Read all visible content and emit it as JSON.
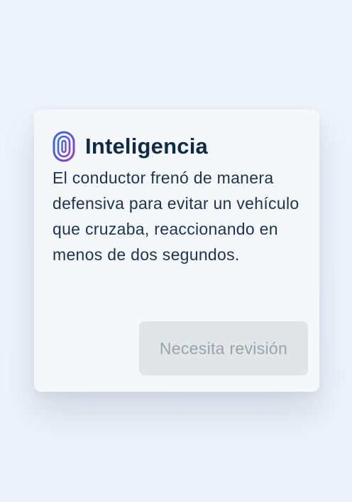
{
  "card": {
    "icon": "fingerprint-icon",
    "title": "Inteligencia",
    "description": "El conductor frenó de manera defensiva para evitar un vehículo que cruzaba, reaccionando en menos de dos segundos.",
    "review_button_label": "Necesita revisión"
  },
  "colors": {
    "icon_gradient_start": "#2f6fe0",
    "icon_gradient_end": "#8a3fc9",
    "title": "#0e2a47",
    "text": "#1b3350",
    "button_bg": "#e1e5e8",
    "button_text": "#9aa3aa",
    "card_bg": "#f5f8fa"
  }
}
